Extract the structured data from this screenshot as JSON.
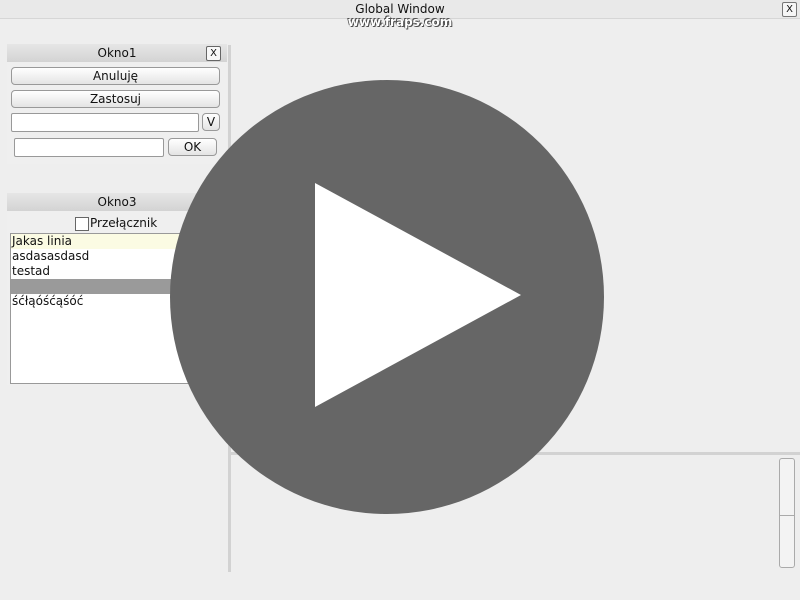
{
  "main_window": {
    "title": "Global Window",
    "close_label": "X"
  },
  "watermark": "www.fraps.com",
  "okno1": {
    "title": "Okno1",
    "close_label": "X",
    "cancel_button": "Anuluję",
    "apply_button": "Zastosuj",
    "dropdown_button": "V",
    "text_input_1": "",
    "text_input_2": "",
    "ok_button": "OK"
  },
  "okno3": {
    "title": "Okno3",
    "checkbox_label": "Przełącznik",
    "checkbox_checked": false,
    "list_items": [
      "Jakas linia",
      "asdasasdasd",
      "testad",
      "",
      "śćłąóśćąśóć"
    ],
    "hovered_index": 0,
    "selected_index": 3
  },
  "overlay": {
    "icon": "play-icon",
    "color": "#666666"
  }
}
